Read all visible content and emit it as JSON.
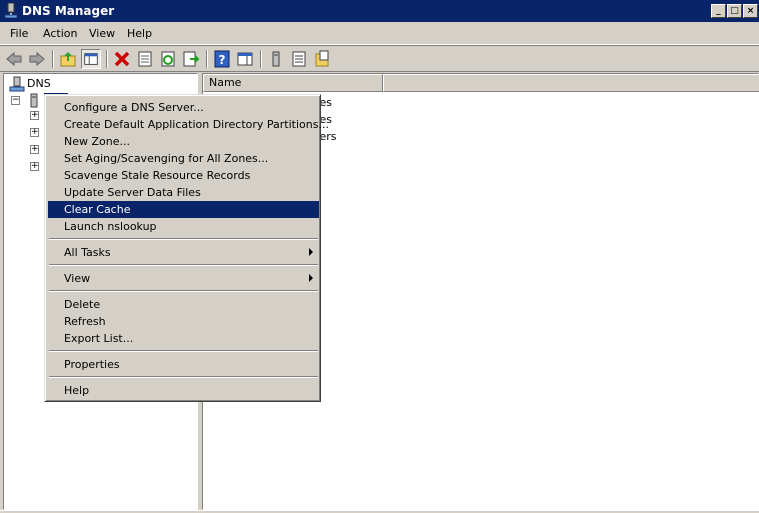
{
  "window": {
    "title": "DNS Manager"
  },
  "menubar": {
    "items": [
      "File",
      "Action",
      "View",
      "Help"
    ]
  },
  "tree": {
    "root_label": "DNS",
    "server_label": "",
    "child_count": 4
  },
  "list": {
    "columns": [
      "Name",
      ""
    ],
    "rows": [
      "...es",
      "...es",
      "...ers"
    ]
  },
  "context_menu": {
    "items": [
      "Configure a DNS Server...",
      "Create Default Application Directory Partitions...",
      "New Zone...",
      "Set Aging/Scavenging for All Zones...",
      "Scavenge Stale Resource Records",
      "Update Server Data Files",
      "Clear Cache",
      "Launch nslookup",
      "All Tasks",
      "View",
      "Delete",
      "Refresh",
      "Export List...",
      "Properties",
      "Help"
    ],
    "highlighted": "Clear Cache"
  },
  "colors": {
    "titlebar": "#0a246a",
    "highlight": "#0a246a",
    "chrome": "#d4d0c8",
    "delete_icon": "#cc0000"
  },
  "toolbar_icons": [
    "back-icon",
    "forward-icon",
    "up-folder-icon",
    "show-hide-tree-icon",
    "delete-icon",
    "properties-icon",
    "refresh-icon",
    "export-list-icon",
    "help-icon",
    "show-hide-action-pane-icon",
    "server-icon",
    "list-icon",
    "new-zone-icon"
  ]
}
